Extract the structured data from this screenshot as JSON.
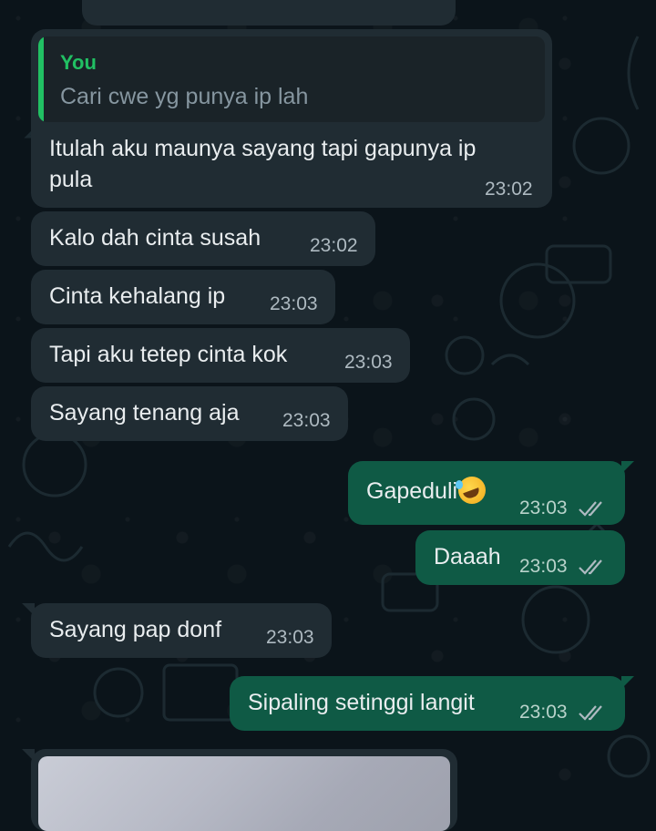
{
  "chat": {
    "quoted": {
      "author": "You",
      "text": "Cari cwe yg punya ip lah"
    },
    "messages": [
      {
        "dir": "in",
        "text": "Itulah aku maunya sayang tapi gapunya ip pula",
        "line1": "Itulah aku maunya sayang tapi gapunya ip",
        "line2": "pula",
        "time": "23:02"
      },
      {
        "dir": "in",
        "text": "Kalo dah cinta susah",
        "time": "23:02"
      },
      {
        "dir": "in",
        "text": "Cinta kehalang ip",
        "time": "23:03"
      },
      {
        "dir": "in",
        "text": "Tapi aku tetep cinta kok",
        "time": "23:03"
      },
      {
        "dir": "in",
        "text": "Sayang tenang aja",
        "time": "23:03"
      },
      {
        "dir": "out",
        "text": "Gapeduli",
        "emoji": "rolling-on-the-floor-laughing",
        "time": "23:03",
        "status": "read"
      },
      {
        "dir": "out",
        "text": "Daaah",
        "time": "23:03",
        "status": "read"
      },
      {
        "dir": "in",
        "text": "Sayang pap donf",
        "time": "23:03"
      },
      {
        "dir": "out",
        "text": "Sipaling setinggi langit",
        "time": "23:03",
        "status": "read"
      }
    ]
  },
  "colors": {
    "background": "#0b141a",
    "incoming_bubble": "#202c33",
    "outgoing_bubble": "#0f5a45",
    "quote_accent": "#21c063",
    "text": "#e9edef",
    "meta_text": "#aebac1"
  }
}
